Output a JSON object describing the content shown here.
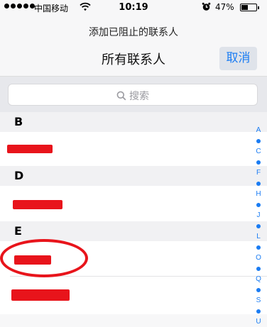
{
  "status_bar": {
    "carrier": "中国移动",
    "time": "10:19",
    "battery": "47%",
    "battery_level": 0.47,
    "icons": [
      "signal-dots-icon",
      "wifi-icon",
      "alarm-icon",
      "battery-icon"
    ]
  },
  "nav": {
    "subtitle": "添加已阻止的联系人",
    "title": "所有联系人",
    "cancel_label": "取消"
  },
  "search": {
    "placeholder": "搜索",
    "icon": "search-icon"
  },
  "sections": [
    {
      "letter": "B"
    },
    {
      "letter": "D"
    },
    {
      "letter": "E"
    }
  ],
  "index_letters": [
    "A",
    "C",
    "F",
    "H",
    "J",
    "L",
    "O",
    "Q",
    "S",
    "U"
  ],
  "colors": {
    "accent": "#1a7cf3",
    "redaction": "#e8141b",
    "section_bg": "#f1f1f3"
  }
}
